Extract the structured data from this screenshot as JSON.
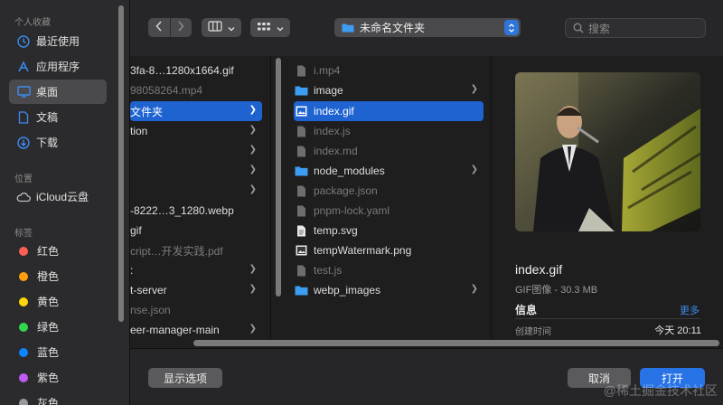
{
  "sidebar": {
    "favorites_title": "个人收藏",
    "favorites": [
      {
        "label": "最近使用",
        "icon": "clock-icon"
      },
      {
        "label": "应用程序",
        "icon": "apps-icon"
      },
      {
        "label": "桌面",
        "icon": "desktop-icon",
        "selected": true
      },
      {
        "label": "文稿",
        "icon": "document-icon"
      },
      {
        "label": "下载",
        "icon": "download-icon"
      }
    ],
    "locations_title": "位置",
    "locations": [
      {
        "label": "iCloud云盘",
        "icon": "cloud-icon"
      }
    ],
    "tags_title": "标签",
    "tags": [
      {
        "label": "红色",
        "color": "#ff5f57"
      },
      {
        "label": "橙色",
        "color": "#ff9f0a"
      },
      {
        "label": "黄色",
        "color": "#ffd60a"
      },
      {
        "label": "绿色",
        "color": "#32d74b"
      },
      {
        "label": "蓝色",
        "color": "#0a84ff"
      },
      {
        "label": "紫色",
        "color": "#bf5af2"
      },
      {
        "label": "灰色",
        "color": "#98989d"
      }
    ]
  },
  "toolbar": {
    "current_folder": "未命名文件夹",
    "search_placeholder": "搜索"
  },
  "column1": [
    {
      "label": "3fa-8…1280x1664.gif",
      "dim": false,
      "chevron": false
    },
    {
      "label": "98058264.mp4",
      "dim": true,
      "chevron": false
    },
    {
      "label": "文件夹",
      "dim": false,
      "chevron": true,
      "selected": true,
      "icon": "folder"
    },
    {
      "label": "tion",
      "dim": false,
      "chevron": true
    },
    {
      "label": "",
      "dim": false,
      "chevron": true
    },
    {
      "label": "",
      "dim": false,
      "chevron": true
    },
    {
      "label": "",
      "dim": false,
      "chevron": true
    },
    {
      "label": "-8222…3_1280.webp",
      "dim": false,
      "chevron": false
    },
    {
      "label": "gif",
      "dim": false,
      "chevron": false
    },
    {
      "label": "cript…开发实践.pdf",
      "dim": true,
      "chevron": false
    },
    {
      "label": ":",
      "dim": false,
      "chevron": true
    },
    {
      "label": "t-server",
      "dim": false,
      "chevron": true
    },
    {
      "label": "nse.json",
      "dim": true,
      "chevron": false
    },
    {
      "label": "eer-manager-main",
      "dim": false,
      "chevron": true
    }
  ],
  "column2": [
    {
      "label": "i.mp4",
      "dim": true,
      "icon": "file",
      "chevron": false
    },
    {
      "label": "image",
      "dim": false,
      "icon": "folder",
      "chevron": true
    },
    {
      "label": "index.gif",
      "dim": false,
      "icon": "image",
      "chevron": false,
      "selected": true
    },
    {
      "label": "index.js",
      "dim": true,
      "icon": "file",
      "chevron": false
    },
    {
      "label": "index.md",
      "dim": true,
      "icon": "file",
      "chevron": false
    },
    {
      "label": "node_modules",
      "dim": false,
      "icon": "folder",
      "chevron": true
    },
    {
      "label": "package.json",
      "dim": true,
      "icon": "file",
      "chevron": false
    },
    {
      "label": "pnpm-lock.yaml",
      "dim": true,
      "icon": "file",
      "chevron": false
    },
    {
      "label": "temp.svg",
      "dim": false,
      "icon": "doc",
      "chevron": false
    },
    {
      "label": "tempWatermark.png",
      "dim": false,
      "icon": "image",
      "chevron": false
    },
    {
      "label": "test.js",
      "dim": true,
      "icon": "file",
      "chevron": false
    },
    {
      "label": "webp_images",
      "dim": false,
      "icon": "folder",
      "chevron": true
    }
  ],
  "preview": {
    "name": "index.gif",
    "kind": "GIF图像 - 30.3 MB",
    "info_label": "信息",
    "more_label": "更多",
    "created_label": "创建时间",
    "created_value": "今天 20:11"
  },
  "buttons": {
    "options": "显示选项",
    "cancel": "取消",
    "open": "打开"
  },
  "watermark": "@稀土掘金技术社区"
}
